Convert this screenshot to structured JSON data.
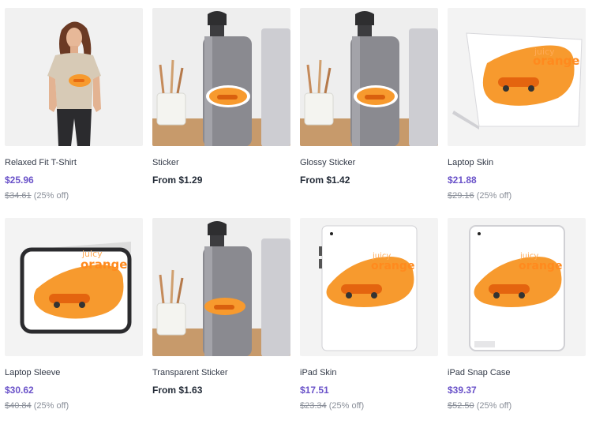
{
  "products": [
    {
      "title": "Relaxed Fit T-Shirt",
      "price": "$25.96",
      "original_price": "$34.61",
      "discount": "(25% off)",
      "image": "tshirt"
    },
    {
      "title": "Sticker",
      "price": "From $1.29",
      "image": "bottle-sticker"
    },
    {
      "title": "Glossy Sticker",
      "price": "From $1.42",
      "image": "bottle-sticker"
    },
    {
      "title": "Laptop Skin",
      "price": "$21.88",
      "original_price": "$29.16",
      "discount": "(25% off)",
      "image": "laptop-skin"
    },
    {
      "title": "Laptop Sleeve",
      "price": "$30.62",
      "original_price": "$40.84",
      "discount": "(25% off)",
      "image": "laptop-sleeve"
    },
    {
      "title": "Transparent Sticker",
      "price": "From $1.63",
      "image": "bottle-sticker"
    },
    {
      "title": "iPad Skin",
      "price": "$17.51",
      "original_price": "$23.34",
      "discount": "(25% off)",
      "image": "ipad-skin"
    },
    {
      "title": "iPad Snap Case",
      "price": "$39.37",
      "original_price": "$52.50",
      "discount": "(25% off)",
      "image": "ipad-case"
    }
  ],
  "artwork": {
    "line1": "juicy",
    "line2": "orange"
  },
  "colors": {
    "sale_price": "#6a52c9",
    "regular_price": "#222a36",
    "accent_orange": "#ff8a1e"
  }
}
